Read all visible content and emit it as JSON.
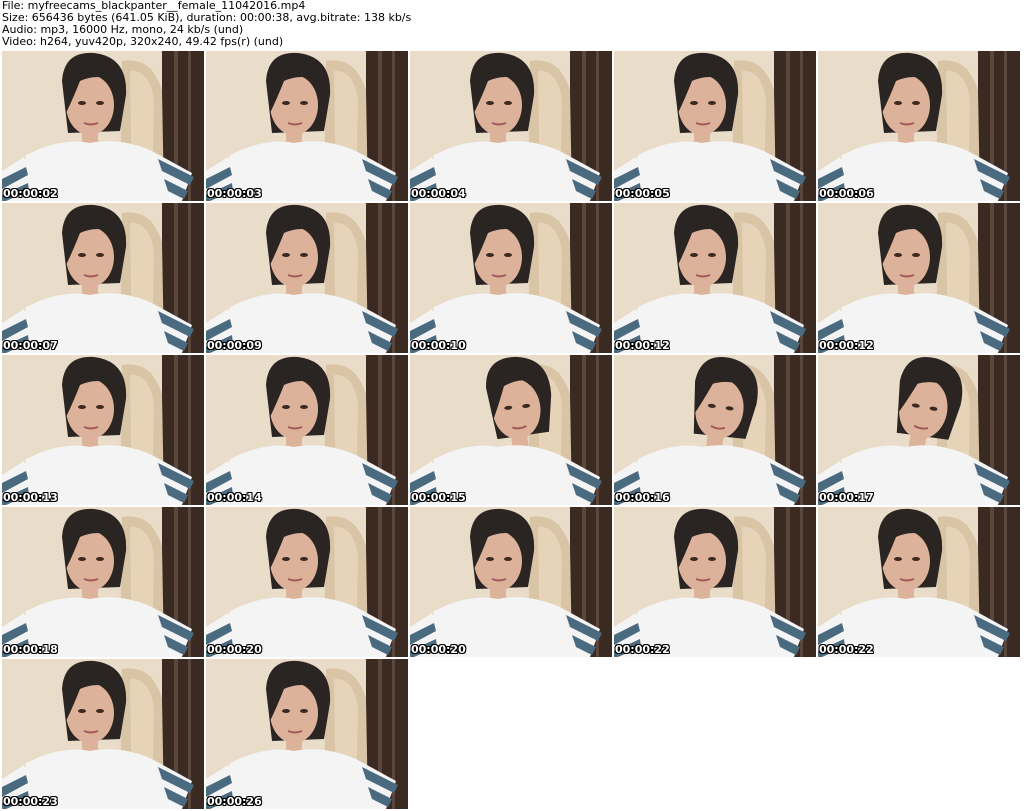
{
  "header": {
    "line1": "File: myfreecams_blackpanter__female_11042016.mp4",
    "line2": "Size: 656436 bytes (641.05 KiB), duration: 00:00:38, avg.bitrate: 138 kb/s",
    "line3": "Audio: mp3, 16000 Hz, mono, 24 kb/s (und)",
    "line4": "Video: h264, yuv420p, 320x240, 49.42 fps(r) (und)"
  },
  "thumbnails": [
    {
      "time": "00:00:02"
    },
    {
      "time": "00:00:03"
    },
    {
      "time": "00:00:04"
    },
    {
      "time": "00:00:05"
    },
    {
      "time": "00:00:06"
    },
    {
      "time": "00:00:07"
    },
    {
      "time": "00:00:09"
    },
    {
      "time": "00:00:10"
    },
    {
      "time": "00:00:12"
    },
    {
      "time": "00:00:12"
    },
    {
      "time": "00:00:13"
    },
    {
      "time": "00:00:14"
    },
    {
      "time": "00:00:15"
    },
    {
      "time": "00:00:16"
    },
    {
      "time": "00:00:17"
    },
    {
      "time": "00:00:18"
    },
    {
      "time": "00:00:20"
    },
    {
      "time": "00:00:20"
    },
    {
      "time": "00:00:22"
    },
    {
      "time": "00:00:22"
    },
    {
      "time": "00:00:23"
    },
    {
      "time": "00:00:26"
    }
  ],
  "colors": {
    "background": "#ffffff",
    "wall": "#e9dcc8",
    "chair": "#d9c4a6",
    "curtain": "#3a2a22",
    "hair": "#2a2422",
    "skin": "#dcb39a",
    "shirt": "#f4f4f4",
    "stripe": "#4a6a80"
  }
}
